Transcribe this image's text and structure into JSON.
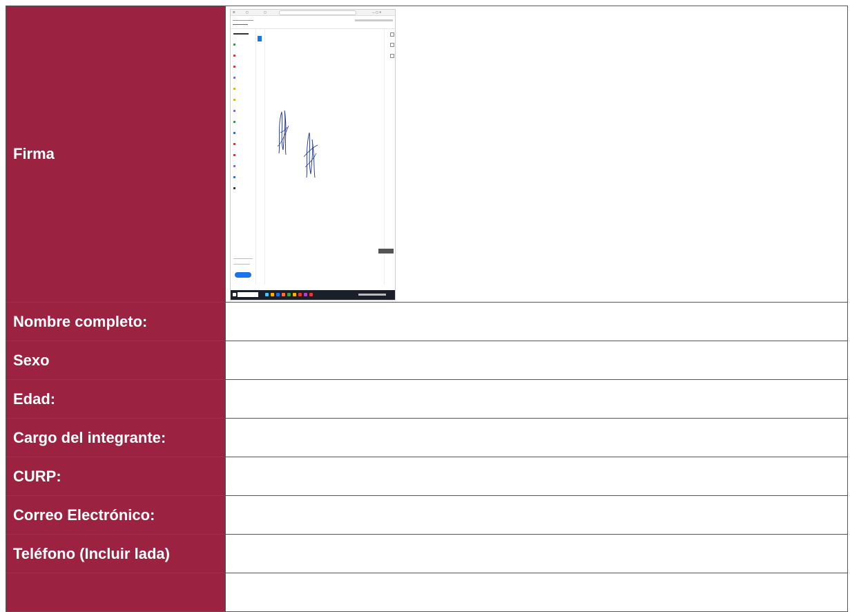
{
  "form": {
    "rows": [
      {
        "label": "Firma"
      },
      {
        "label": "Nombre completo:"
      },
      {
        "label": "Sexo"
      },
      {
        "label": "Edad:"
      },
      {
        "label": "Cargo del integrante:"
      },
      {
        "label": "CURP:"
      },
      {
        "label": "Correo Electrónico:"
      },
      {
        "label": "Teléfono (Incluir lada)"
      },
      {
        "label": ""
      }
    ]
  },
  "colors": {
    "label_bg": "#9b2240",
    "label_text": "#ffffff",
    "border": "#555555",
    "signature_ink": "#1c2f86"
  },
  "embedded_screenshot": {
    "description_icons": [
      "browser-tab-icon",
      "pdf-tool-icon",
      "signature-drawing",
      "taskbar-icon"
    ]
  }
}
